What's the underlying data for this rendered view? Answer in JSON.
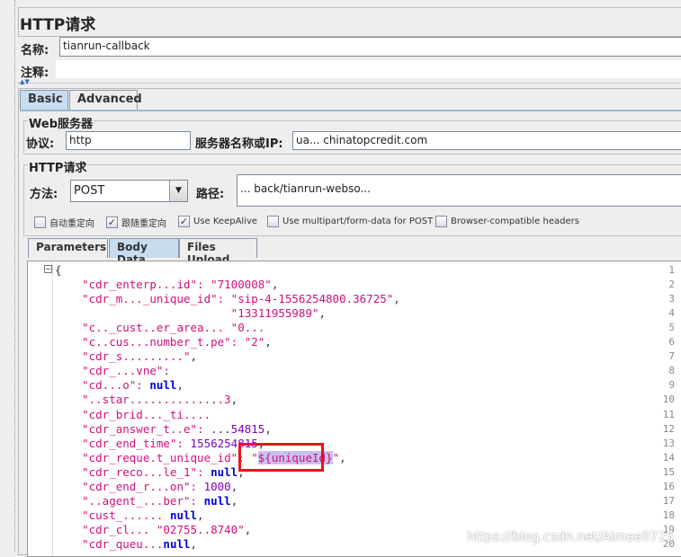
{
  "title": "HTTP请求",
  "name_label": "名称:",
  "name_value": "tianrun-callback",
  "comment_label": "注释:",
  "comment_value": "",
  "tabs": [
    {
      "label": "Basic",
      "active": true
    },
    {
      "label": "Advanced",
      "active": false
    }
  ],
  "web_server": {
    "group_title": "Web服务器",
    "protocol_label": "协议:",
    "protocol_value": "http",
    "server_label": "服务器名称或IP:",
    "server_value": "ua...   chinatopcredit.com"
  },
  "http_request": {
    "group_title": "HTTP请求",
    "method_label": "方法:",
    "method_value": "POST",
    "path_label": "路径:",
    "path_value": "...     back/tianrun-webso..."
  },
  "checkboxes": [
    {
      "label": "自动重定向",
      "checked": false
    },
    {
      "label": "跟随重定向",
      "checked": true
    },
    {
      "label": "Use KeepAlive",
      "checked": true
    },
    {
      "label": "Use multipart/form-data for POST",
      "checked": false
    },
    {
      "label": "Browser-compatible headers",
      "checked": false
    }
  ],
  "subtabs": [
    {
      "label": "Parameters",
      "active": false
    },
    {
      "label": "Body Data",
      "active": true
    },
    {
      "label": "Files Upload",
      "active": false
    }
  ],
  "body_lines": [
    [
      [
        "p",
        "{"
      ]
    ],
    [
      [
        "s",
        "    \"cdr_enterp...id\": \"7100008\""
      ],
      [
        "p",
        ","
      ]
    ],
    [
      [
        "s",
        "    \"cdr_m..._unique_id\": \"sip-4-1556254800.36725\""
      ],
      [
        "p",
        ","
      ]
    ],
    [
      [
        "s",
        "                          \"13311955989\""
      ],
      [
        "p",
        ","
      ]
    ],
    [
      [
        "s",
        "    \"c.._cust..er_area... \"0..."
      ]
    ],
    [
      [
        "s",
        "    \"c..cus...number_t.pe\": \"2\""
      ],
      [
        "p",
        ","
      ]
    ],
    [
      [
        "s",
        "    \"cdr_s.........\""
      ],
      [
        "p",
        ","
      ]
    ],
    [
      [
        "s",
        "    \"cdr_...vne\":"
      ]
    ],
    [
      [
        "s",
        "    \"cd...o\": "
      ],
      [
        "n",
        "null"
      ],
      [
        "p",
        ","
      ]
    ],
    [
      [
        "s",
        "    \"..star..............3"
      ],
      [
        "p",
        ","
      ]
    ],
    [
      [
        "s",
        "    \"cdr_brid..._ti...."
      ]
    ],
    [
      [
        "s",
        "    \"cdr_answer_t..e\": "
      ],
      [
        "num",
        "...54815"
      ],
      [
        "p",
        ","
      ]
    ],
    [
      [
        "s",
        "    \"cdr_end_time\": "
      ],
      [
        "num",
        "1556254815"
      ],
      [
        "p",
        ","
      ]
    ],
    [
      [
        "s",
        "    \"cdr_reque.t_unique_id\": \""
      ],
      [
        "h",
        "${uniqueId}"
      ],
      [
        "s",
        "\""
      ],
      [
        "p",
        ","
      ]
    ],
    [
      [
        "s",
        "    \"cdr_reco...le_1\": "
      ],
      [
        "n",
        "null"
      ],
      [
        "p",
        ","
      ]
    ],
    [
      [
        "s",
        "    \"cdr_end_r...on\": "
      ],
      [
        "num",
        "1000"
      ],
      [
        "p",
        ","
      ]
    ],
    [
      [
        "s",
        "    \"..agent_...ber\": "
      ],
      [
        "n",
        "null"
      ],
      [
        "p",
        ","
      ]
    ],
    [
      [
        "s",
        "    \"cust_...... "
      ],
      [
        "n",
        "null"
      ],
      [
        "p",
        ","
      ]
    ],
    [
      [
        "s",
        "    \"cdr_cl... \"02755..8740\""
      ],
      [
        "p",
        ","
      ]
    ],
    [
      [
        "s",
        "    \"cdr_queu..."
      ],
      [
        "n",
        "null"
      ],
      [
        "p",
        ","
      ]
    ]
  ],
  "watermark": "https://blog.csdn.net/Aimee0725",
  "colors": {
    "highlight_box": "#e8141c",
    "string": "#d0107a",
    "keyword_null": "#0000e0",
    "number": "#8000c0",
    "active_tab": "#c8dcf0"
  }
}
